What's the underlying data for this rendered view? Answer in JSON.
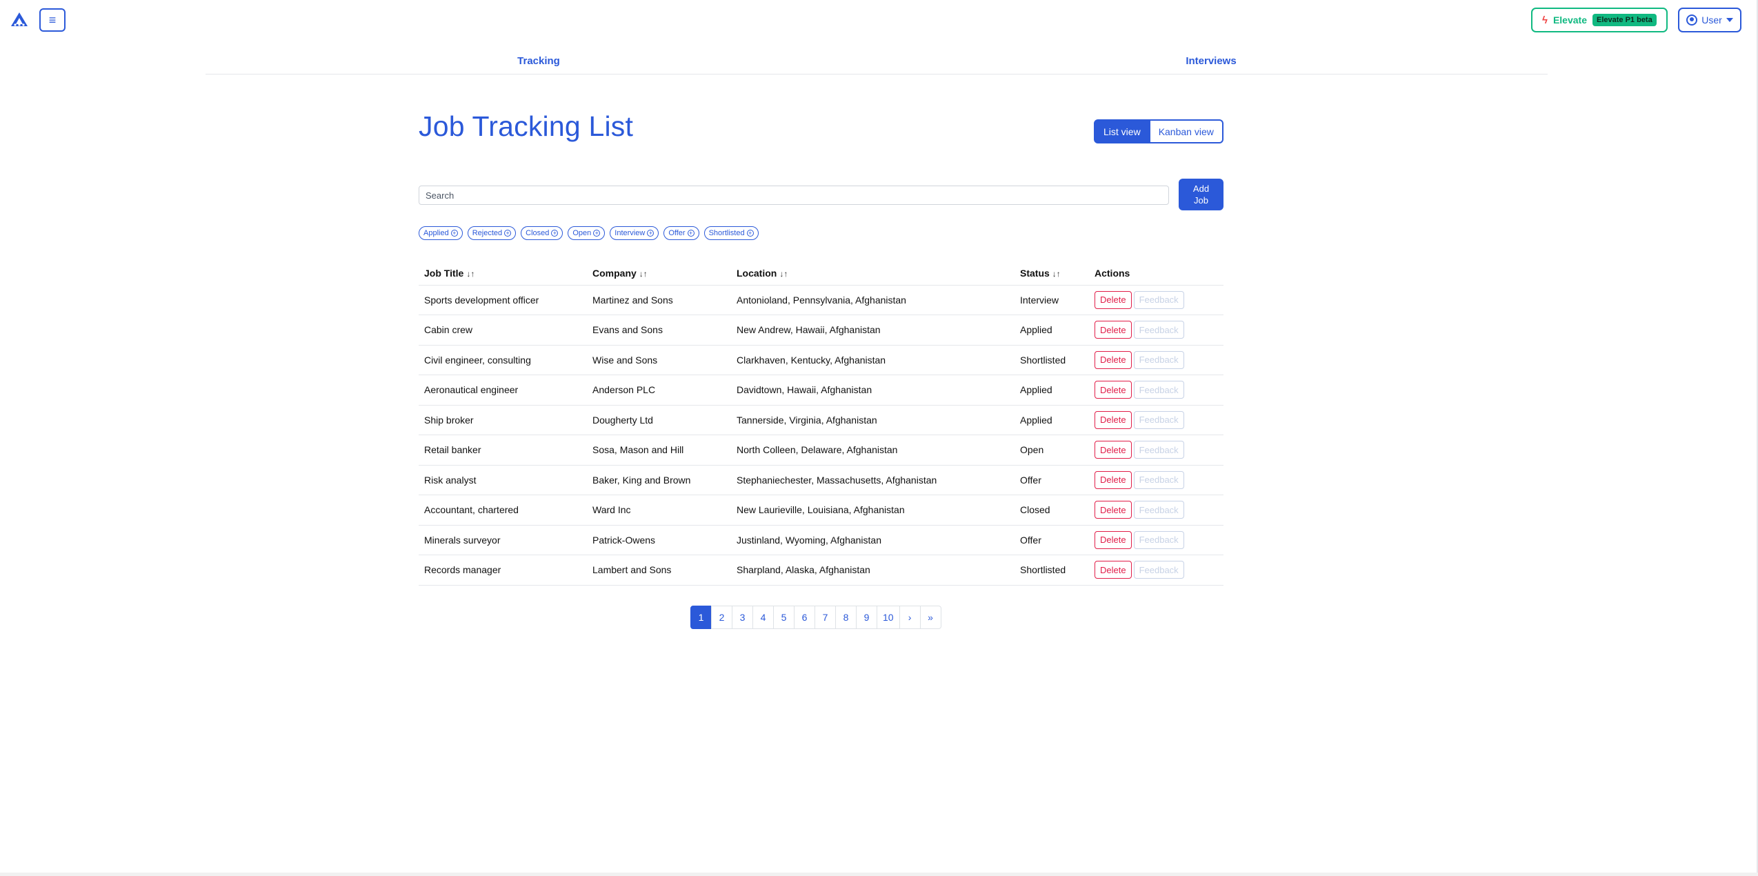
{
  "header": {
    "menu_icon": "≡",
    "elevate_label": "Elevate",
    "elevate_badge": "Elevate P1 beta",
    "user_label": "User"
  },
  "tabs": [
    {
      "label": "Tracking"
    },
    {
      "label": "Interviews"
    }
  ],
  "main": {
    "title": "Job Tracking List",
    "view_toggle": {
      "list": "List view",
      "kanban": "Kanban view",
      "selected": "List view"
    },
    "search": {
      "placeholder": "Search",
      "value": ""
    },
    "add_job_label": "Add Job",
    "filters": [
      "Applied",
      "Rejected",
      "Closed",
      "Open",
      "Interview",
      "Offer",
      "Shortlisted"
    ]
  },
  "table": {
    "columns": [
      "Job Title",
      "Company",
      "Location",
      "Status",
      "Actions"
    ],
    "sort_icon": "↓↑",
    "delete_label": "Delete",
    "feedback_label": "Feedback",
    "rows": [
      {
        "title": "Sports development officer",
        "company": "Martinez and Sons",
        "location": "Antonioland, Pennsylvania, Afghanistan",
        "status": "Interview"
      },
      {
        "title": "Cabin crew",
        "company": "Evans and Sons",
        "location": "New Andrew, Hawaii, Afghanistan",
        "status": "Applied"
      },
      {
        "title": "Civil engineer, consulting",
        "company": "Wise and Sons",
        "location": "Clarkhaven, Kentucky, Afghanistan",
        "status": "Shortlisted"
      },
      {
        "title": "Aeronautical engineer",
        "company": "Anderson PLC",
        "location": "Davidtown, Hawaii, Afghanistan",
        "status": "Applied"
      },
      {
        "title": "Ship broker",
        "company": "Dougherty Ltd",
        "location": "Tannerside, Virginia, Afghanistan",
        "status": "Applied"
      },
      {
        "title": "Retail banker",
        "company": "Sosa, Mason and Hill",
        "location": "North Colleen, Delaware, Afghanistan",
        "status": "Open"
      },
      {
        "title": "Risk analyst",
        "company": "Baker, King and Brown",
        "location": "Stephaniechester, Massachusetts, Afghanistan",
        "status": "Offer"
      },
      {
        "title": "Accountant, chartered",
        "company": "Ward Inc",
        "location": "New Laurieville, Louisiana, Afghanistan",
        "status": "Closed"
      },
      {
        "title": "Minerals surveyor",
        "company": "Patrick-Owens",
        "location": "Justinland, Wyoming, Afghanistan",
        "status": "Offer"
      },
      {
        "title": "Records manager",
        "company": "Lambert and Sons",
        "location": "Sharpland, Alaska, Afghanistan",
        "status": "Shortlisted"
      }
    ]
  },
  "pagination": {
    "pages": [
      "1",
      "2",
      "3",
      "4",
      "5",
      "6",
      "7",
      "8",
      "9",
      "10",
      "›",
      "»"
    ],
    "current": "1"
  },
  "colors": {
    "accent": "#2b59d9",
    "elevate": "#10b981",
    "danger": "#e11d48"
  }
}
